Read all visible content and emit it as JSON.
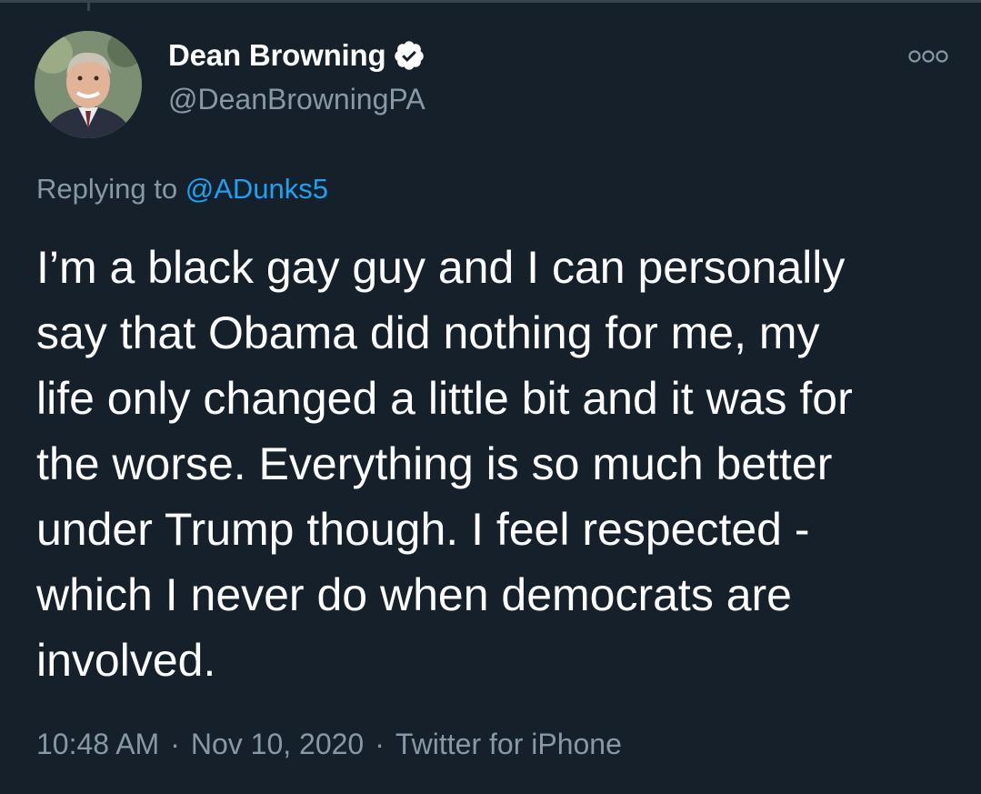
{
  "tweet": {
    "author": {
      "display_name": "Dean Browning",
      "handle": "@DeanBrowningPA",
      "verified": true,
      "verified_icon": "verified-badge-icon"
    },
    "more_icon": "more-options-icon",
    "replying_prefix": "Replying to",
    "replying_to": "@ADunks5",
    "text": "I’m a black gay guy and I can personally\nsay that Obama did nothing for me, my\nlife only changed a little bit and it was for\nthe worse. Everything is so much better\nunder Trump though. I feel respected -\nwhich I never do when democrats are\ninvolved.",
    "time": "10:48 AM",
    "separator": "·",
    "date": "Nov 10, 2020",
    "source": "Twitter for iPhone"
  },
  "colors": {
    "background": "#15202b",
    "text": "#ffffff",
    "secondary": "#8899a6",
    "accent": "#1da1f2"
  }
}
